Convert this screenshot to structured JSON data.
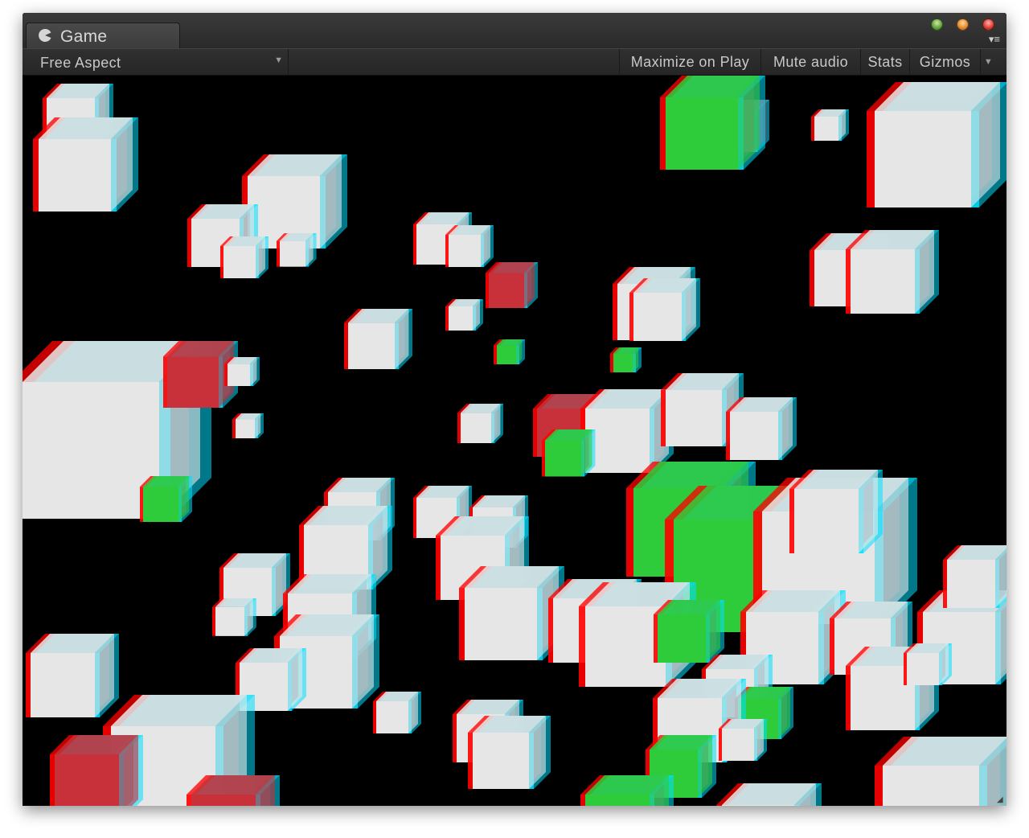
{
  "window": {
    "tab_title": "Game",
    "tab_icon": "pacman-icon",
    "traffic_lights": [
      "green",
      "orange",
      "red"
    ],
    "menu_icon": "panel-menu-icon"
  },
  "toolbar": {
    "aspect_label": "Free Aspect",
    "maximize_label": "Maximize on Play",
    "mute_label": "Mute audio",
    "stats_label": "Stats",
    "gizmos_label": "Gizmos"
  },
  "colors": {
    "cube_white": "#e6e6e6",
    "cube_green": "#2ecc3a",
    "cube_red": "#c8303a",
    "anaglyph_left": "#ff0000",
    "anaglyph_right": "#00e0ff",
    "background": "#000000"
  }
}
